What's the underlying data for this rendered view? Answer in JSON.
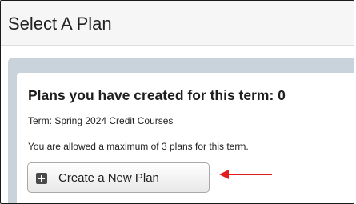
{
  "header": {
    "title": "Select A Plan"
  },
  "plans": {
    "heading": "Plans you have created for this term: 0",
    "term": "Term: Spring 2024 Credit Courses",
    "limit_note": "You are allowed a maximum of 3 plans for this term.",
    "create_button_label": "Create a New Plan"
  },
  "icons": {
    "button_icon": "plus-square-icon",
    "annotation": "arrow-left-icon"
  },
  "colors": {
    "panel_background": "#c9d3dc",
    "annotation_arrow": "#e21b1b"
  }
}
